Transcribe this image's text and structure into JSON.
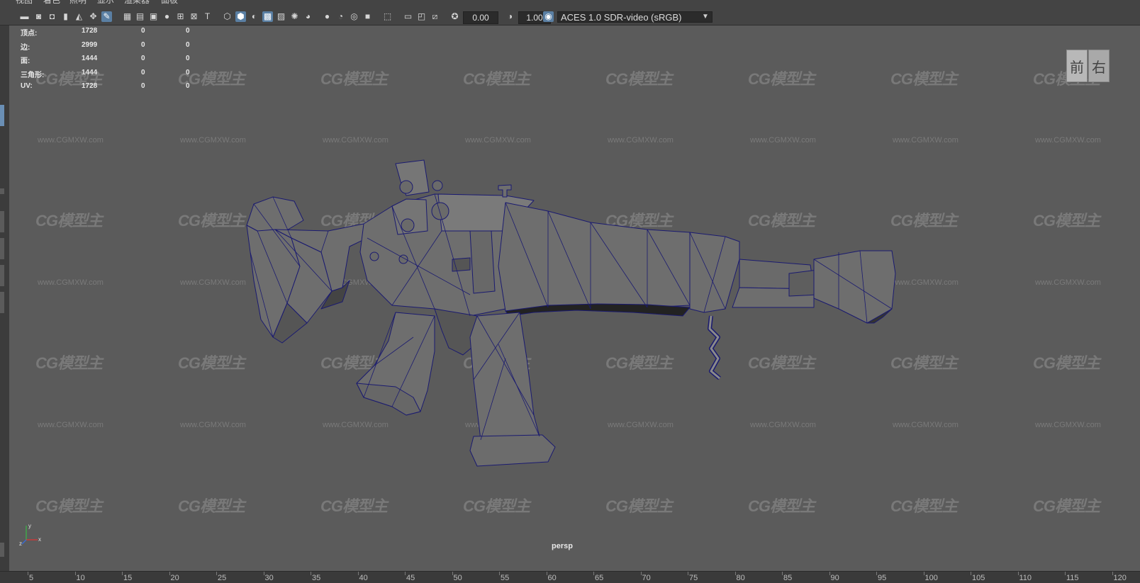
{
  "menu": {
    "items": [
      "视图",
      "着色",
      "照明",
      "显示",
      "渲染器",
      "面板"
    ]
  },
  "toolbar": {
    "exposure": "0.00",
    "gamma": "1.00",
    "colorspace": "ACES 1.0 SDR-video (sRGB)",
    "icons": [
      "camera-icon",
      "camera-attributes-icon",
      "bookmark-icon",
      "image-plane-icon",
      "grid-toggle-icon",
      "pencil-icon",
      "grid-icon",
      "film-gate-icon",
      "resolution-gate-icon",
      "gate-mask-icon",
      "field-chart-icon",
      "safe-action-icon",
      "safe-title-icon",
      "wireframe-icon",
      "smooth-shade-icon",
      "wireframe-on-shaded-icon",
      "xray-icon",
      "use-all-lights-icon",
      "shadows-icon",
      "screen-space-ao-icon",
      "motion-blur-icon",
      "multisample-aa-icon",
      "depth-of-field-icon",
      "isolate-select-icon",
      "exposure-icon",
      "gamma-icon",
      "color-management-icon"
    ]
  },
  "hud": {
    "rows": [
      {
        "label": "顶点:",
        "v1": "1728",
        "v2": "0",
        "v3": "0"
      },
      {
        "label": "边:",
        "v1": "2999",
        "v2": "0",
        "v3": "0"
      },
      {
        "label": "面:",
        "v1": "1444",
        "v2": "0",
        "v3": "0"
      },
      {
        "label": "三角形:",
        "v1": "1444",
        "v2": "0",
        "v3": "0"
      },
      {
        "label": "UV:",
        "v1": "1728",
        "v2": "0",
        "v3": "0"
      }
    ]
  },
  "viewcube": {
    "front": "前",
    "right": "右"
  },
  "viewport": {
    "camera_label": "persp",
    "watermark_logo": "CG模型主",
    "watermark_url": "www.CGMXW.com"
  },
  "axis": {
    "y": "y",
    "x": "x",
    "z": "z"
  },
  "ruler": {
    "labels": [
      "5",
      "10",
      "15",
      "20",
      "25",
      "30",
      "35",
      "40",
      "45",
      "50",
      "55",
      "60",
      "65",
      "70",
      "75",
      "80",
      "85",
      "90",
      "95",
      "100",
      "105",
      "110",
      "115",
      "120"
    ]
  },
  "colors": {
    "viewport_bg": "#5b5b5b",
    "ui_bg": "#444444",
    "wireframe": "#1a1a6e",
    "model_fill": "#6b6b6b"
  }
}
